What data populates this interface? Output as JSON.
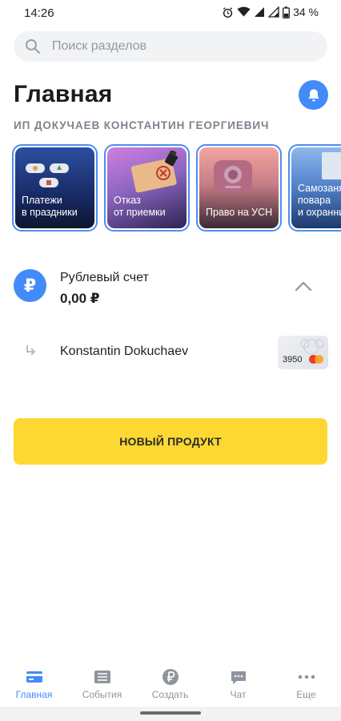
{
  "status_bar": {
    "time": "14:26",
    "battery": "34 %"
  },
  "search": {
    "placeholder": "Поиск разделов",
    "value": ""
  },
  "header": {
    "title": "Главная",
    "company": "ИП ДОКУЧАЕВ КОНСТАНТИН ГЕОРГИЕВИЧ"
  },
  "stories": [
    {
      "line1": "Платежи",
      "line2": "в праздники"
    },
    {
      "line1": "Отказ",
      "line2": "от приемки"
    },
    {
      "line1": "Право на УСН",
      "line2": ""
    },
    {
      "line1": "Самозанятые",
      "line2": "повара",
      "line3": "и охранники"
    }
  ],
  "account": {
    "currency_symbol": "₽",
    "name": "Рублевый счет",
    "balance": "0,00 ₽",
    "card_owner": "Konstantin Dokuchaev",
    "card_last_digits": "3950"
  },
  "new_product_label": "НОВЫЙ ПРОДУКТ",
  "nav": [
    {
      "label": "Главная",
      "icon": "card-icon"
    },
    {
      "label": "События",
      "icon": "list-icon"
    },
    {
      "label": "Создать",
      "icon": "ruble-icon"
    },
    {
      "label": "Чат",
      "icon": "chat-icon"
    },
    {
      "label": "Еще",
      "icon": "more-icon"
    }
  ],
  "colors": {
    "accent": "#428bf9",
    "brand_yellow": "#fdd832",
    "story_border": "#4d8cf3",
    "muted_text": "#7d848d"
  }
}
